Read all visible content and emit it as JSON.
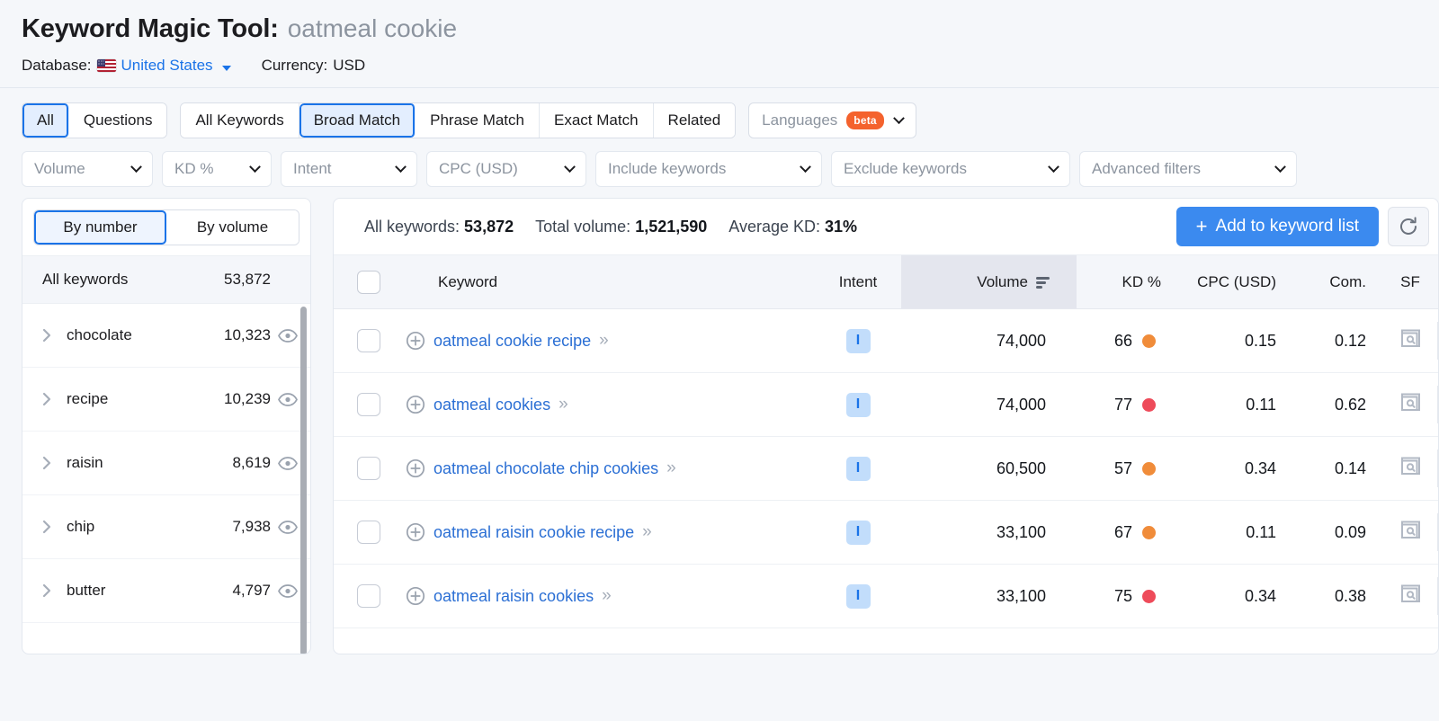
{
  "header": {
    "tool_name": "Keyword Magic Tool:",
    "query": "oatmeal cookie",
    "database_label": "Database:",
    "database_value": "United States",
    "flag_icon": "us-flag-icon",
    "currency_label": "Currency:",
    "currency_value": "USD"
  },
  "filters": {
    "question_group": [
      {
        "label": "All",
        "active": true
      },
      {
        "label": "Questions",
        "active": false
      }
    ],
    "match_group": [
      {
        "label": "All Keywords",
        "active": false
      },
      {
        "label": "Broad Match",
        "active": true
      },
      {
        "label": "Phrase Match",
        "active": false
      },
      {
        "label": "Exact Match",
        "active": false
      },
      {
        "label": "Related",
        "active": false
      }
    ],
    "languages": {
      "label": "Languages",
      "badge": "beta"
    },
    "dropdowns": [
      "Volume",
      "KD %",
      "Intent",
      "CPC (USD)",
      "Include keywords",
      "Exclude keywords",
      "Advanced filters"
    ]
  },
  "sidebar": {
    "tabs": [
      {
        "label": "By number",
        "active": true
      },
      {
        "label": "By volume",
        "active": false
      }
    ],
    "all_row": {
      "label": "All keywords",
      "count": "53,872"
    },
    "groups": [
      {
        "label": "chocolate",
        "count": "10,323"
      },
      {
        "label": "recipe",
        "count": "10,239"
      },
      {
        "label": "raisin",
        "count": "8,619"
      },
      {
        "label": "chip",
        "count": "7,938"
      },
      {
        "label": "butter",
        "count": "4,797"
      }
    ]
  },
  "results": {
    "stats": [
      {
        "label": "All keywords:",
        "value": "53,872"
      },
      {
        "label": "Total volume:",
        "value": "1,521,590"
      },
      {
        "label": "Average KD:",
        "value": "31%"
      }
    ],
    "add_button": "Add to keyword list",
    "refresh_icon": "refresh-icon",
    "columns": [
      {
        "key": "keyword",
        "label": "Keyword"
      },
      {
        "key": "intent",
        "label": "Intent"
      },
      {
        "key": "volume",
        "label": "Volume",
        "sorted": true
      },
      {
        "key": "kd",
        "label": "KD %"
      },
      {
        "key": "cpc",
        "label": "CPC (USD)"
      },
      {
        "key": "com",
        "label": "Com."
      },
      {
        "key": "sf",
        "label": "SF"
      }
    ],
    "rows": [
      {
        "keyword": "oatmeal cookie recipe",
        "intent": "I",
        "volume": "74,000",
        "kd": "66",
        "kd_color": "#f08c3a",
        "cpc": "0.15",
        "com": "0.12",
        "sf": "serp-feature-icon"
      },
      {
        "keyword": "oatmeal cookies",
        "intent": "I",
        "volume": "74,000",
        "kd": "77",
        "kd_color": "#ee4b5a",
        "cpc": "0.11",
        "com": "0.62",
        "sf": "serp-feature-icon"
      },
      {
        "keyword": "oatmeal chocolate chip cookies",
        "intent": "I",
        "volume": "60,500",
        "kd": "57",
        "kd_color": "#f08c3a",
        "cpc": "0.34",
        "com": "0.14",
        "sf": "serp-feature-icon"
      },
      {
        "keyword": "oatmeal raisin cookie recipe",
        "intent": "I",
        "volume": "33,100",
        "kd": "67",
        "kd_color": "#f08c3a",
        "cpc": "0.11",
        "com": "0.09",
        "sf": "serp-feature-icon"
      },
      {
        "keyword": "oatmeal raisin cookies",
        "intent": "I",
        "volume": "33,100",
        "kd": "75",
        "kd_color": "#ee4b5a",
        "cpc": "0.34",
        "com": "0.38",
        "sf": "serp-feature-icon"
      }
    ]
  },
  "colors": {
    "accent_blue": "#1a73e8",
    "button_blue": "#3b8aef",
    "link_blue": "#2b6fd4",
    "beta_orange": "#f4622d",
    "kd_orange": "#f08c3a",
    "kd_red": "#ee4b5a",
    "page_bg": "#f5f7fa"
  }
}
